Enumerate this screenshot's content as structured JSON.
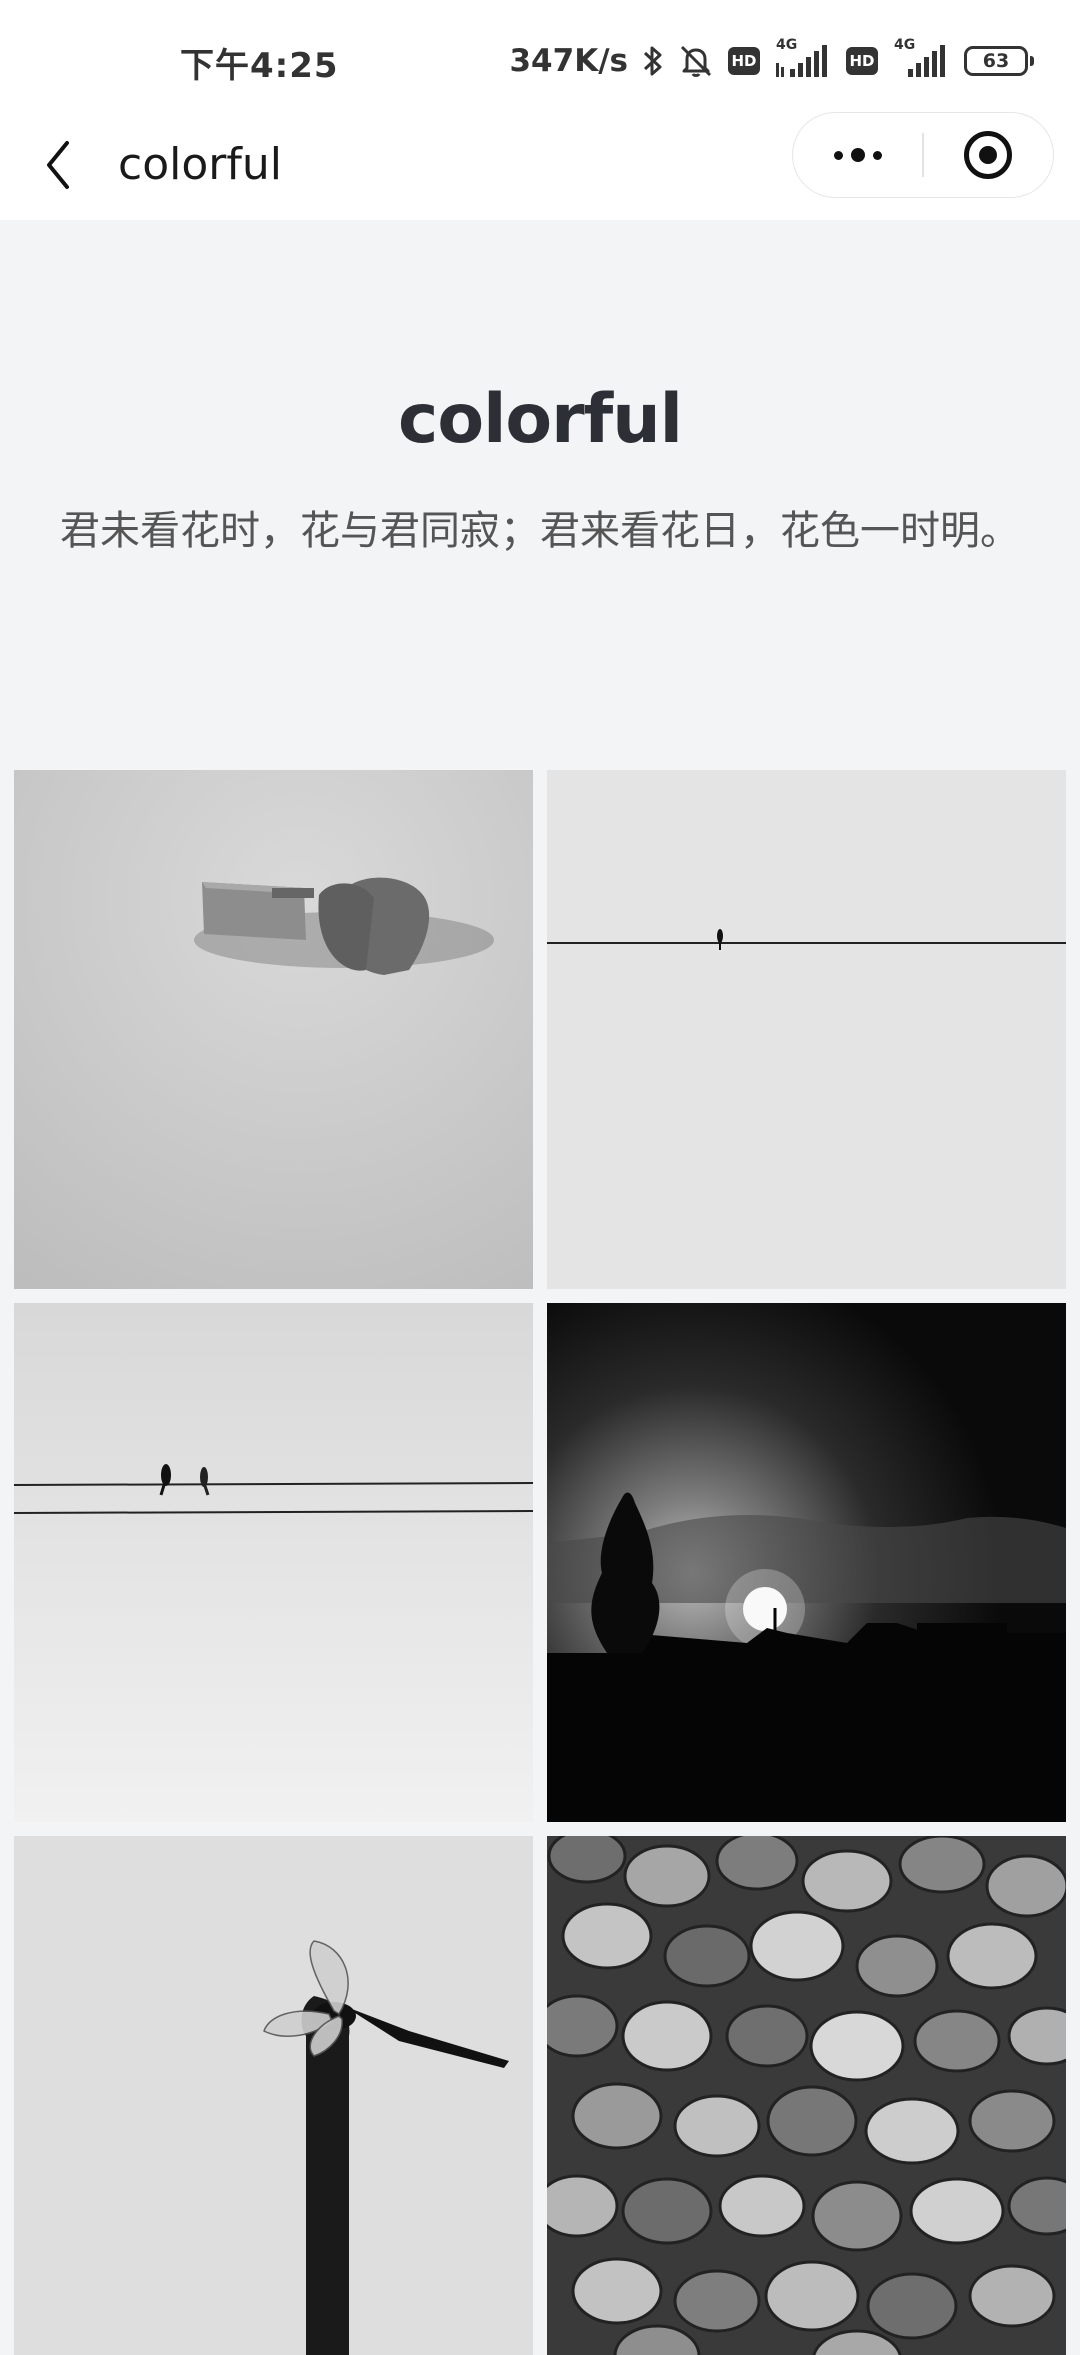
{
  "status_bar": {
    "time": "下午4:25",
    "net_speed": "347K/s",
    "hd1": "HD",
    "hd2": "HD",
    "net_type1": "4G",
    "net_type2": "4G",
    "battery": "63"
  },
  "nav": {
    "title": "colorful"
  },
  "hero": {
    "title": "colorful",
    "subtitle": "君未看花时，花与君同寂；君来看花日，花色一时明。"
  },
  "photos": [
    {
      "subject": "heart-clothespin"
    },
    {
      "subject": "bird-on-wire"
    },
    {
      "subject": "two-birds-on-wires"
    },
    {
      "subject": "sunset-silhouette"
    },
    {
      "subject": "dragonfly-on-stick"
    },
    {
      "subject": "clams"
    }
  ],
  "colors": {
    "page_bg": "#f3f4f6",
    "bar_bg": "#ffffff",
    "title": "#2d2f36",
    "subtitle": "#555555"
  }
}
